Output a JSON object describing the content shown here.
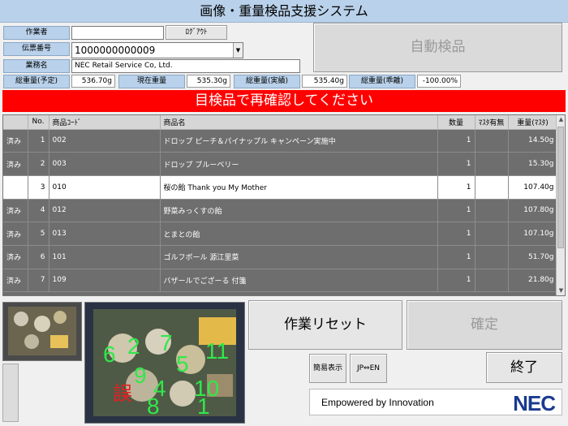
{
  "app": {
    "title": "画像・重量検品支援システム"
  },
  "header": {
    "worker_label": "作業者",
    "worker_value": "",
    "logout_button": "ﾛｸﾞｱｳﾄ",
    "slip_label": "伝票番号",
    "slip_value": "1000000000009",
    "business_label": "業務名",
    "business_value": "NEC Retail Service Co, Ltd.",
    "auto_inspect_button": "自動検品"
  },
  "weights": {
    "planned_label": "総重量(予定)",
    "planned_value": "536.70g",
    "current_label": "現在重量",
    "current_value": "535.30g",
    "actual_label": "総重量(実績)",
    "actual_value": "535.40g",
    "deviation_label": "総重量(乖離)",
    "deviation_value": "-100.00%"
  },
  "alert": {
    "message": "目検品で再確認してください"
  },
  "table": {
    "headers": [
      "",
      "No.",
      "商品ｺｰﾄﾞ",
      "商品名",
      "数量",
      "ﾏｽﾀ有無",
      "重量(ﾏｽﾀ)"
    ],
    "rows": [
      {
        "status": "済み",
        "no": "1",
        "code": "002",
        "name": "ドロップ ピーチ＆パイナップル キャンペーン実施中",
        "qty": "1",
        "master": "",
        "weight": "14.50g"
      },
      {
        "status": "済み",
        "no": "2",
        "code": "003",
        "name": "ドロップ ブルーベリー",
        "qty": "1",
        "master": "",
        "weight": "15.30g"
      },
      {
        "status": "",
        "no": "3",
        "code": "010",
        "name": "桜の飴 Thank you My Mother",
        "qty": "1",
        "master": "",
        "weight": "107.40g"
      },
      {
        "status": "済み",
        "no": "4",
        "code": "012",
        "name": "野菜みっくすの飴",
        "qty": "1",
        "master": "",
        "weight": "107.80g"
      },
      {
        "status": "済み",
        "no": "5",
        "code": "013",
        "name": "とまとの飴",
        "qty": "1",
        "master": "",
        "weight": "107.10g"
      },
      {
        "status": "済み",
        "no": "6",
        "code": "101",
        "name": "ゴルフボール 源江里菜",
        "qty": "1",
        "master": "",
        "weight": "51.70g"
      },
      {
        "status": "済み",
        "no": "7",
        "code": "109",
        "name": "バザールでござーる 付箋",
        "qty": "1",
        "master": "",
        "weight": "21.80g"
      }
    ]
  },
  "camera": {
    "labels": [
      "6",
      "2",
      "7",
      "11",
      "5",
      "9",
      "4",
      "10",
      "8",
      "1"
    ],
    "error_label": "誤"
  },
  "controls": {
    "reset_button": "作業リセット",
    "confirm_button": "確定",
    "simple_display_button": "簡易表示",
    "lang_button": "JP⇔EN",
    "exit_button": "終了"
  },
  "brand": {
    "tagline": "Empowered by Innovation",
    "logo": "NEC"
  }
}
